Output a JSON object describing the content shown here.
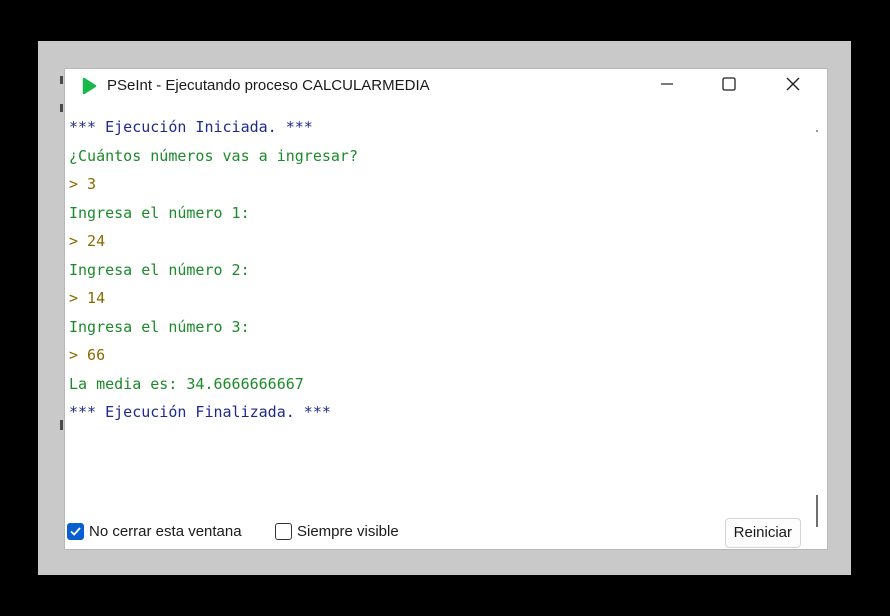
{
  "window": {
    "title": "PSeInt - Ejecutando proceso CALCULARMEDIA",
    "icons": {
      "app": "pseint-play-icon",
      "minimize": "minimize-icon",
      "maximize": "maximize-icon",
      "close": "close-icon"
    }
  },
  "console": {
    "lines": [
      {
        "text": "*** Ejecución Iniciada. ***",
        "kind": "status"
      },
      {
        "text": "¿Cuántos números vas a ingresar?",
        "kind": "prompt"
      },
      {
        "text": "> 3",
        "kind": "input"
      },
      {
        "text": "Ingresa el número 1:",
        "kind": "prompt"
      },
      {
        "text": "> 24",
        "kind": "input"
      },
      {
        "text": "Ingresa el número 2:",
        "kind": "prompt"
      },
      {
        "text": "> 14",
        "kind": "input"
      },
      {
        "text": "Ingresa el número 3:",
        "kind": "prompt"
      },
      {
        "text": "> 66",
        "kind": "input"
      },
      {
        "text": "La media es: 34.6666666667",
        "kind": "prompt"
      },
      {
        "text": "*** Ejecución Finalizada. ***",
        "kind": "status"
      }
    ]
  },
  "footer": {
    "keep_open_label": "No cerrar esta ventana",
    "keep_open_checked": true,
    "always_visible_label": "Siempre visible",
    "always_visible_checked": false,
    "restart_label": "Reiniciar"
  },
  "colors": {
    "status": "#1f2a8c",
    "prompt": "#1c8a2a",
    "input": "#8a6a00",
    "checkbox_accent": "#0a5fd0",
    "app_icon": "#18b84a"
  }
}
